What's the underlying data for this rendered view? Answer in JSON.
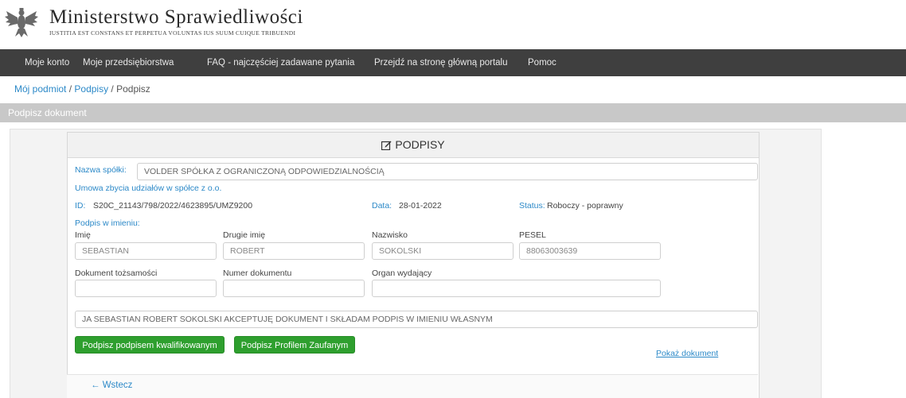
{
  "header": {
    "title": "Ministerstwo Sprawiedliwości",
    "motto": "IUSTITIA EST CONSTANS ET PERPETUA VOLUNTAS IUS SUUM CUIQUE TRIBUENDI",
    "logo_icon": "eagle-emblem-icon"
  },
  "nav": {
    "items": [
      "Moje konto",
      "Moje przedsiębiorstwa",
      "FAQ - najczęściej zadawane pytania",
      "Przejdź na stronę główną portalu",
      "Pomoc"
    ]
  },
  "breadcrumb": {
    "item1": "Mój podmiot",
    "sep1": " / ",
    "item2": "Podpisy",
    "sep2": " / ",
    "current": "Podpisz"
  },
  "section": {
    "title": "Podpisz dokument"
  },
  "card": {
    "title": "PODPISY",
    "title_icon": "edit-icon",
    "company_label": "Nazwa spółki:",
    "company_value": "VOLDER SPÓŁKA Z OGRANICZONĄ ODPOWIEDZIALNOŚCIĄ",
    "doc_type": "Umowa zbycia udziałów w spółce z o.o.",
    "id_label": "ID:",
    "id_value": "S20C_21143/798/2022/4623895/UMZ9200",
    "date_label": "Data:",
    "date_value": "28-01-2022",
    "status_label": "Status:",
    "status_value": "Roboczy - poprawny",
    "on_behalf": "Podpis w imieniu:",
    "fields": {
      "first_name_label": "Imię",
      "first_name_value": "SEBASTIAN",
      "middle_name_label": "Drugie imię",
      "middle_name_value": "ROBERT",
      "last_name_label": "Nazwisko",
      "last_name_value": "SOKOLSKI",
      "pesel_label": "PESEL",
      "pesel_value": "88063003639",
      "id_doc_label": "Dokument tożsamości",
      "id_doc_value": "",
      "doc_number_label": "Numer dokumentu",
      "doc_number_value": "",
      "issuer_label": "Organ wydający",
      "issuer_value": ""
    },
    "declaration": "JA SEBASTIAN ROBERT SOKOLSKI AKCEPTUJĘ DOKUMENT I SKŁADAM PODPIS W IMIENIU WŁASNYM",
    "btn_qualified": "Podpisz podpisem kwalifikowanym",
    "btn_trusted": "Podpisz Profilem Zaufanym",
    "show_doc": "Pokaż dokument"
  },
  "footer": {
    "back": "Wstecz",
    "back_icon": "arrow-left-icon"
  },
  "colors": {
    "accent": "#2c89c8",
    "button_green": "#2e9f2e",
    "nav_bg": "#3f3f3f"
  }
}
